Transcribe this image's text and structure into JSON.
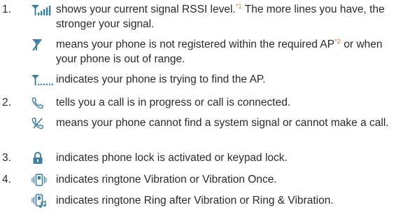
{
  "items": [
    {
      "number": "1.",
      "icon": "signal-strength-icon",
      "text_a": "shows your current signal RSSI level.",
      "footnote": "*1",
      "text_b": " The more lines you have, the stronger your signal."
    },
    {
      "number": "",
      "icon": "no-service-antenna-icon",
      "text_a": "means your phone is not registered within the required AP",
      "footnote": "*2",
      "text_b": " or when your phone is out of range."
    },
    {
      "number": "",
      "icon": "searching-signal-icon",
      "text_a": "indicates your phone is trying to find the AP."
    },
    {
      "number": "2.",
      "icon": "phone-handset-icon",
      "text_a": "tells you a call is in progress or call is connected."
    },
    {
      "number": "",
      "icon": "phone-crossed-icon",
      "text_a": "means your phone cannot find a system signal or cannot make a call."
    },
    {
      "number": "3.",
      "icon": "padlock-icon",
      "text_a": "indicates phone lock is activated or keypad lock."
    },
    {
      "number": "4.",
      "icon": "vibration-icon",
      "text_a": "indicates ringtone Vibration or Vibration Once."
    },
    {
      "number": "",
      "icon": "ring-after-vibration-icon",
      "text_a": "indicates ringtone Ring after Vibration or Ring & Vibration."
    }
  ],
  "colors": {
    "icon_blue": "#3d7fa3",
    "footnote_orange": "#e8762d",
    "text": "#2a2a2a"
  }
}
